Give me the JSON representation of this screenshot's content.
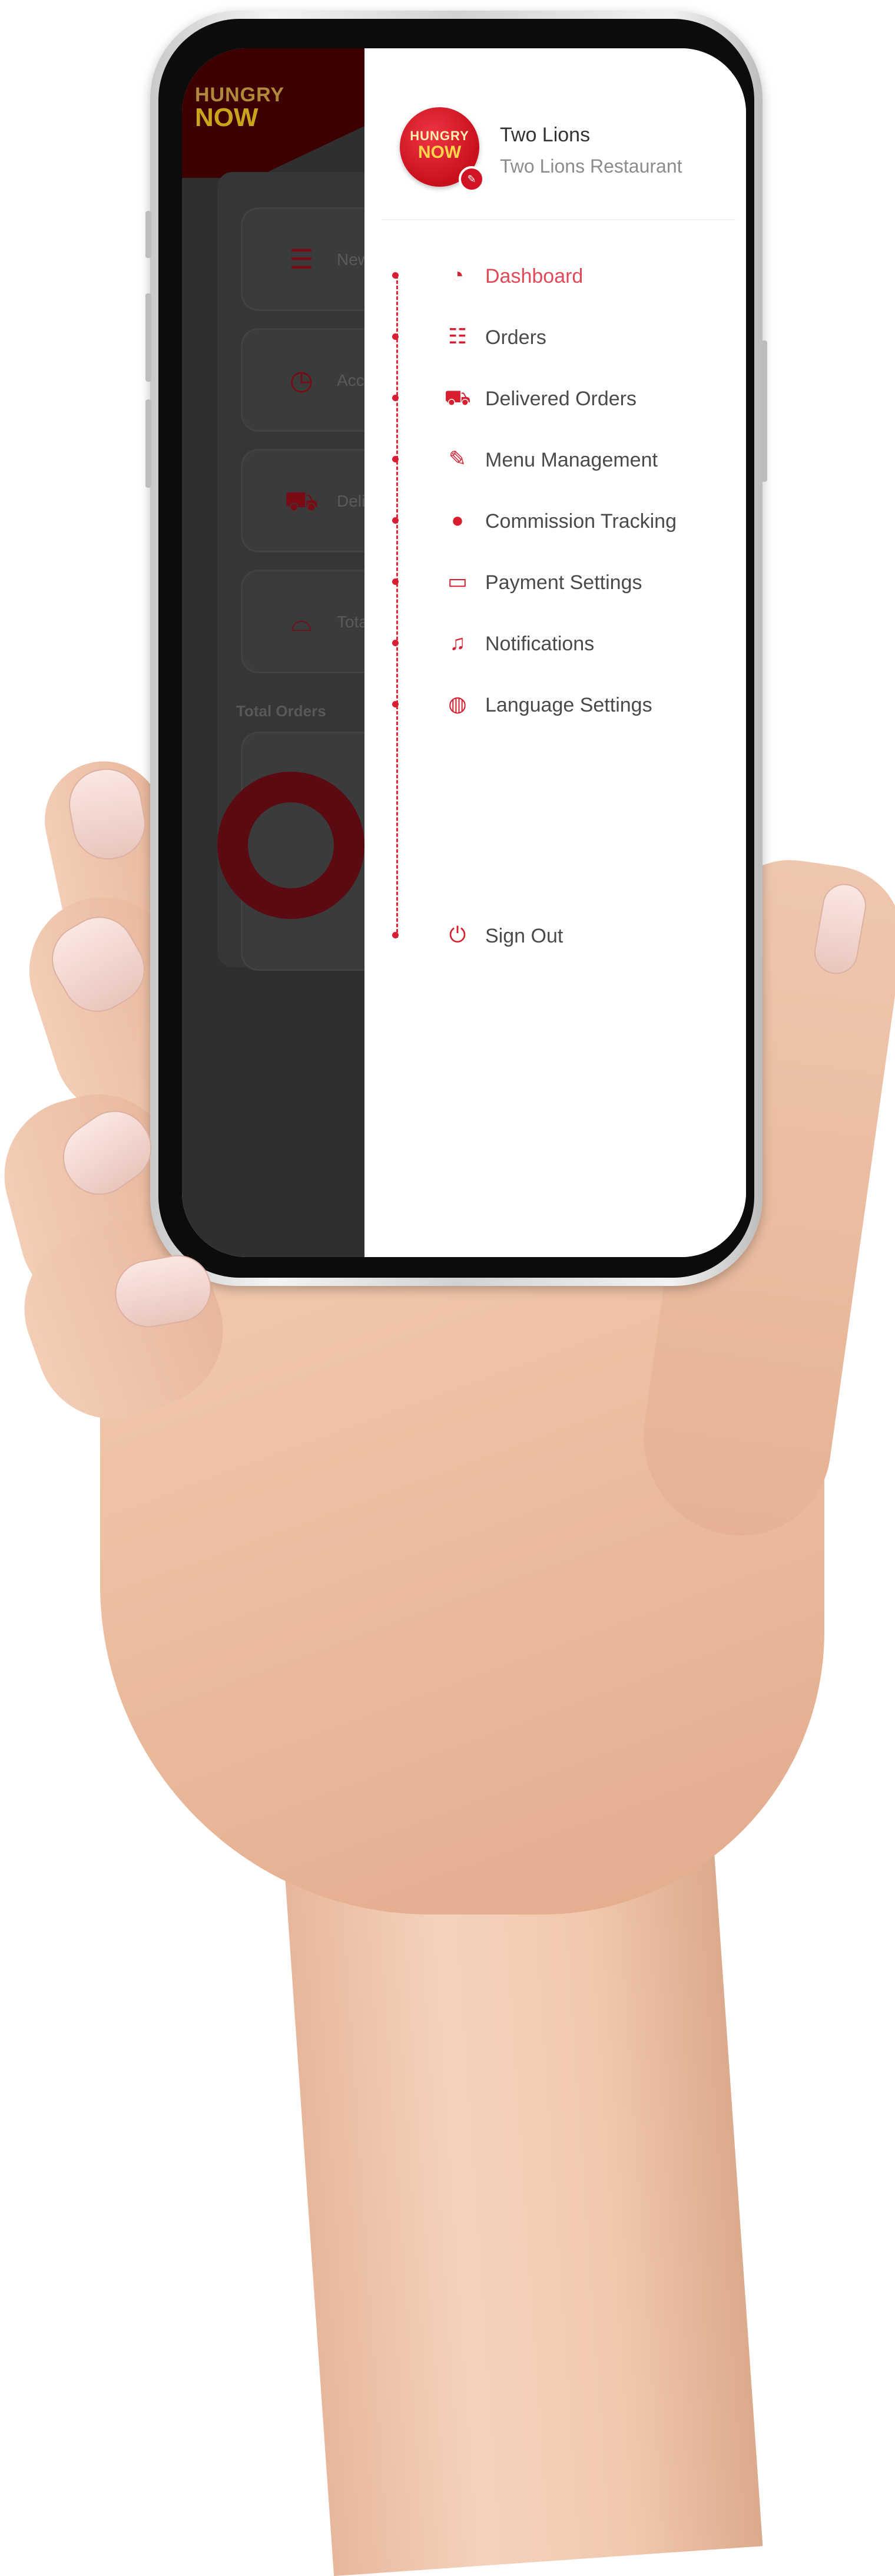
{
  "app": {
    "brand_line1": "HUNGRY",
    "brand_line2": "NOW",
    "accent_color": "#d81e2f"
  },
  "background_app": {
    "cards": [
      {
        "icon": "list-icon",
        "label": "New"
      },
      {
        "icon": "clock-icon",
        "label": "Acce"
      },
      {
        "icon": "truck-icon",
        "label": "Deli"
      },
      {
        "icon": "cloche-icon",
        "label": "Tota"
      }
    ],
    "total_orders_label": "Total Orders"
  },
  "profile": {
    "name": "Two Lions",
    "restaurant": "Two Lions Restaurant"
  },
  "menu": [
    {
      "label": "Dashboard",
      "icon": "speedometer-icon",
      "active": true
    },
    {
      "label": "Orders",
      "icon": "orders-list-icon",
      "active": false
    },
    {
      "label": "Delivered Orders",
      "icon": "delivery-truck-icon",
      "active": false
    },
    {
      "label": "Menu Management",
      "icon": "menu-edit-icon",
      "active": false
    },
    {
      "label": "Commission Tracking",
      "icon": "location-pin-icon",
      "active": false
    },
    {
      "label": "Payment Settings",
      "icon": "payment-card-icon",
      "active": false
    },
    {
      "label": "Notifications",
      "icon": "bell-icon",
      "active": false
    },
    {
      "label": "Language Settings",
      "icon": "globe-icon",
      "active": false
    }
  ],
  "sign_out": {
    "label": "Sign Out",
    "icon": "power-icon"
  }
}
